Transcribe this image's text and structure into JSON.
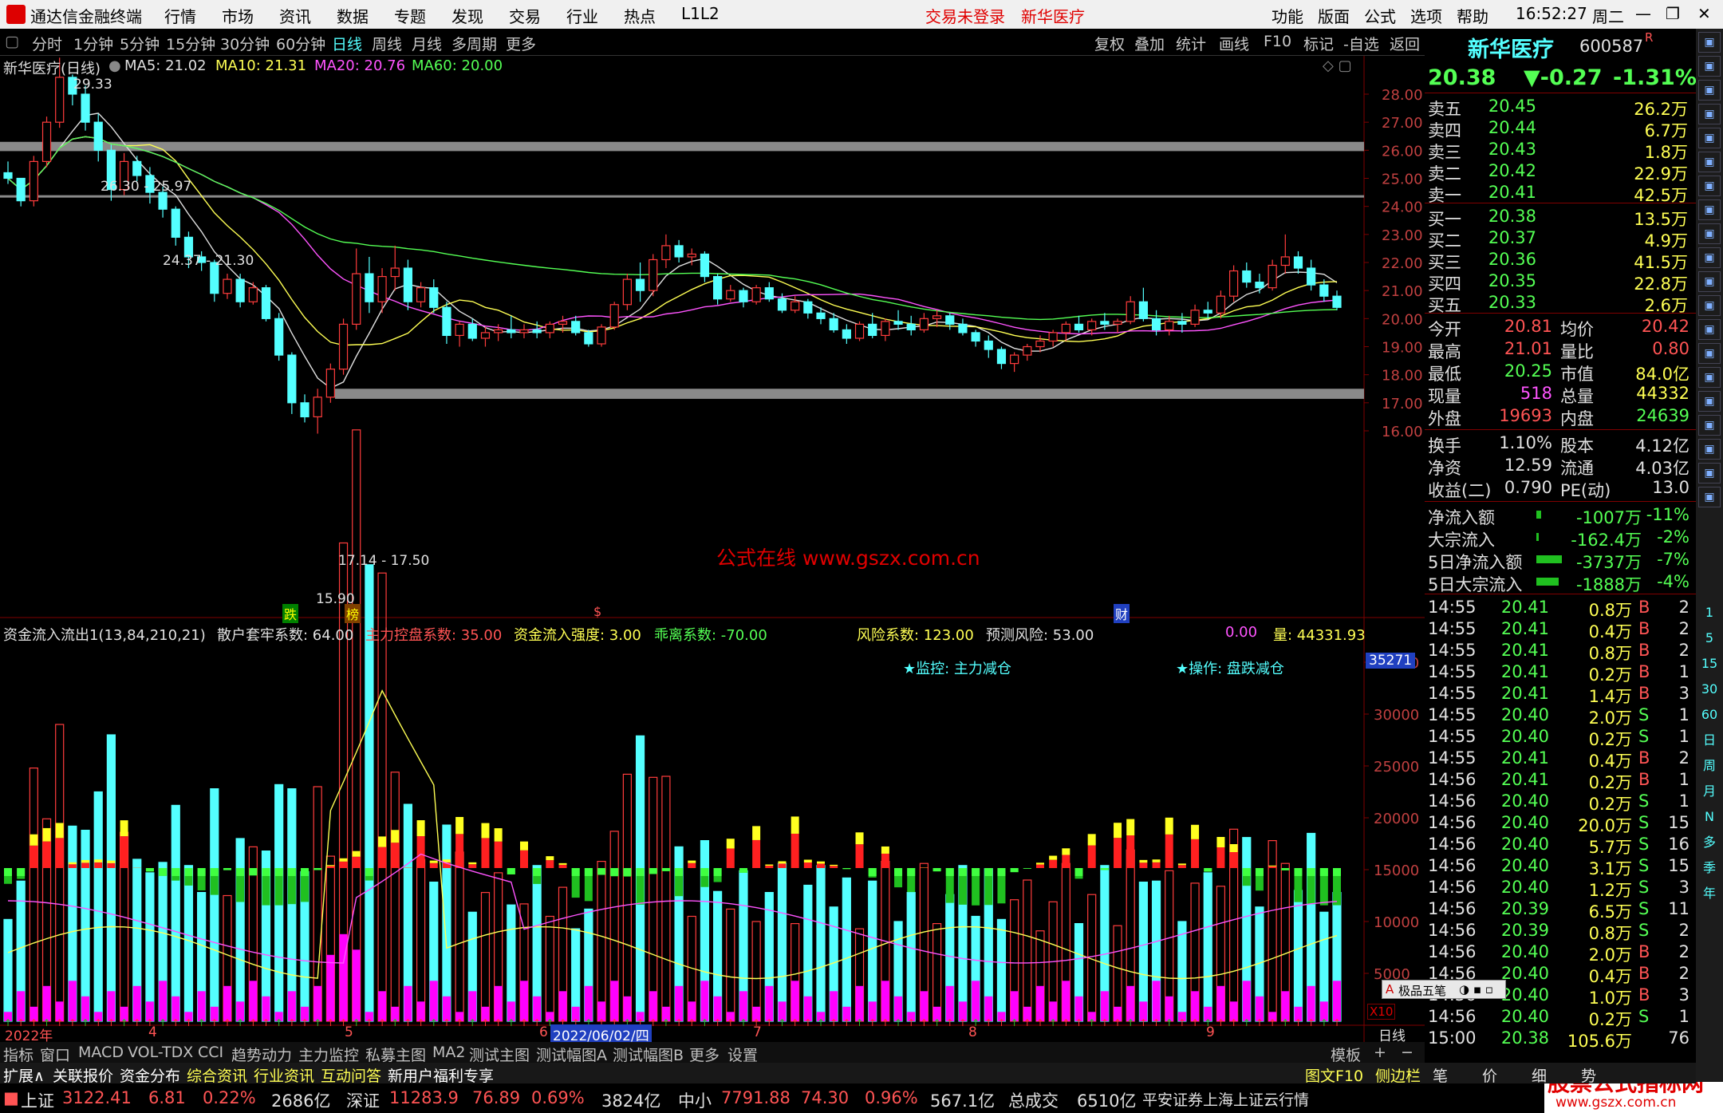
{
  "app": {
    "title": "通达信金融终端",
    "menu": [
      "行情",
      "市场",
      "资讯",
      "数据",
      "专题",
      "发现",
      "交易",
      "行业",
      "热点",
      "L1L2"
    ],
    "center_left": "交易未登录",
    "center_right": "新华医疗",
    "right_menu": [
      "功能",
      "版面",
      "公式",
      "选项",
      "帮助"
    ],
    "time": "16:52:27",
    "weekday": "周二"
  },
  "timeframes": [
    "分时",
    "1分钟",
    "5分钟",
    "15分钟",
    "30分钟",
    "60分钟",
    "日线",
    "周线",
    "月线",
    "多周期",
    "更多"
  ],
  "toolbar_right": [
    "复权",
    "叠加",
    "统计",
    "画线",
    "F10",
    "标记",
    "-自选",
    "返回"
  ],
  "chart_header": {
    "name": "新华医疗(日线)",
    "ma5": "MA5: 21.02",
    "ma10": "MA10: 21.31",
    "ma20": "MA20: 20.76",
    "ma60": "MA60: 20.00"
  },
  "price_axis": [
    "28.00",
    "27.00",
    "26.00",
    "25.00",
    "24.00",
    "23.00",
    "22.00",
    "21.00",
    "20.00",
    "19.00",
    "18.00",
    "17.00",
    "16.00"
  ],
  "annotations": {
    "high": "29.33",
    "low": "15.90",
    "z1": "26.30 - 25.97",
    "z2": "24.37 - 21.30",
    "z3": "17.14 - 17.50",
    "watermark": "公式在线  www.gszx.com.cn",
    "m1": "跌",
    "m2": "榜",
    "m3": "$",
    "m4": "财"
  },
  "indicator": {
    "name": "资金流入流出1(13,84,210,21)",
    "p1": "散户套牢系数: 64.00",
    "p2": "主力控盘系数: 35.00",
    "p3": "资金流入强度: 3.00",
    "p4": "乖离系数: -70.00",
    "p5": "风险系数: 123.00",
    "p6": "预测风险: 53.00",
    "p7": "0.00",
    "p8": "量: 44331.93",
    "monitor": "★监控: 主力减仓",
    "operation": "★操作: 盘跌减仓",
    "vol_badge": "35271",
    "x10": "X10",
    "axis": [
      "35000",
      "30000",
      "25000",
      "20000",
      "15000",
      "10000",
      "5000"
    ]
  },
  "date_axis": [
    "2022年",
    "4",
    "5",
    "6",
    "2022/06/02/四",
    "7",
    "8",
    "9",
    "日线"
  ],
  "tabs_row1": [
    "指标",
    "窗口",
    "MACD",
    "VOL-TDX",
    "CCI",
    "趋势动力",
    "主力监控",
    "私募主图",
    "MA2",
    "测试主图",
    "测试幅图A",
    "测试幅图B",
    "更多",
    "设置"
  ],
  "tabs_row2": [
    "扩展∧",
    "关联报价",
    "资金分布",
    "综合资讯",
    "行业资讯",
    "互动问答",
    "新用户福利专享"
  ],
  "template_btn": "模板",
  "status": {
    "sh": "上证",
    "sh_v": "3122.41",
    "sh_c": "6.81",
    "sh_p": "0.22%",
    "sh_a": "2686亿",
    "sz": "深证",
    "sz_v": "11283.9",
    "sz_c": "76.89",
    "sz_p": "0.69%",
    "sz_a": "3824亿",
    "zx": "中小",
    "zx_v": "7791.88",
    "zx_c": "74.30",
    "zx_p": "0.96%",
    "zx_a": "567.1亿",
    "total": "总成交",
    "total_v": "6510亿",
    "broker": "平安证券上海上证云行情",
    "logo": "股票公式指标网",
    "logo_url": "www.gszx.com.cn"
  },
  "quote": {
    "name": "新华医疗",
    "code": "600587",
    "flag": "R",
    "price": "20.38",
    "change": "▼-0.27",
    "pct": "-1.31%",
    "asks": [
      [
        "卖五",
        "20.45",
        "26.2万"
      ],
      [
        "卖四",
        "20.44",
        "6.7万"
      ],
      [
        "卖三",
        "20.43",
        "1.8万"
      ],
      [
        "卖二",
        "20.42",
        "22.9万"
      ],
      [
        "卖一",
        "20.41",
        "42.5万"
      ]
    ],
    "bids": [
      [
        "买一",
        "20.38",
        "13.5万"
      ],
      [
        "买二",
        "20.37",
        "4.9万"
      ],
      [
        "买三",
        "20.36",
        "41.5万"
      ],
      [
        "买四",
        "20.35",
        "22.8万"
      ],
      [
        "买五",
        "20.33",
        "2.6万"
      ]
    ],
    "stats": [
      [
        "今开",
        "20.81",
        "均价",
        "20.42"
      ],
      [
        "最高",
        "21.01",
        "量比",
        "0.80"
      ],
      [
        "最低",
        "20.25",
        "市值",
        "84.0亿"
      ],
      [
        "现量",
        "518",
        "总量",
        "44332"
      ],
      [
        "外盘",
        "19693",
        "内盘",
        "24639"
      ]
    ],
    "fin": [
      [
        "换手",
        "1.10%",
        "股本",
        "4.12亿"
      ],
      [
        "净资",
        "12.59",
        "流通",
        "4.03亿"
      ],
      [
        "收益(二)",
        "0.790",
        "PE(动)",
        "13.0"
      ]
    ],
    "flows": [
      [
        "净流入额",
        "-1007万",
        "-11%"
      ],
      [
        "大宗流入",
        "-162.4万",
        "-2%"
      ],
      [
        "5日净流入额",
        "-3737万",
        "-7%"
      ],
      [
        "5日大宗流入",
        "-1888万",
        "-4%"
      ]
    ],
    "ticks": [
      [
        "14:55",
        "20.41",
        "0.8万",
        "B",
        "2"
      ],
      [
        "14:55",
        "20.41",
        "0.4万",
        "B",
        "2"
      ],
      [
        "14:55",
        "20.41",
        "0.8万",
        "B",
        "2"
      ],
      [
        "14:55",
        "20.41",
        "0.2万",
        "B",
        "1"
      ],
      [
        "14:55",
        "20.41",
        "1.4万",
        "B",
        "3"
      ],
      [
        "14:55",
        "20.40",
        "2.0万",
        "S",
        "1"
      ],
      [
        "14:55",
        "20.40",
        "0.2万",
        "S",
        "1"
      ],
      [
        "14:55",
        "20.41",
        "0.4万",
        "B",
        "2"
      ],
      [
        "14:56",
        "20.41",
        "0.2万",
        "B",
        "1"
      ],
      [
        "14:56",
        "20.40",
        "0.2万",
        "S",
        "1"
      ],
      [
        "14:56",
        "20.40",
        "20.0万",
        "S",
        "15"
      ],
      [
        "14:56",
        "20.40",
        "5.7万",
        "S",
        "16"
      ],
      [
        "14:56",
        "20.40",
        "3.1万",
        "S",
        "15"
      ],
      [
        "14:56",
        "20.40",
        "1.2万",
        "S",
        "3"
      ],
      [
        "14:56",
        "20.39",
        "6.5万",
        "S",
        "11"
      ],
      [
        "14:56",
        "20.39",
        "0.8万",
        "S",
        "2"
      ],
      [
        "14:56",
        "20.40",
        "2.0万",
        "B",
        "2"
      ],
      [
        "14:56",
        "20.40",
        "0.4万",
        "B",
        "2"
      ],
      [
        "14:56",
        "20.40",
        "1.0万",
        "B",
        "3"
      ],
      [
        "14:56",
        "20.40",
        "0.2万",
        "S",
        "1"
      ],
      [
        "15:00",
        "20.38",
        "105.6万",
        "",
        "76"
      ]
    ],
    "ime": "极品五笔",
    "bottom_tabs": [
      "图文F10",
      "侧边栏",
      "笔",
      "价",
      "细",
      "势"
    ]
  },
  "side_tools": [
    "1",
    "5",
    "15",
    "30",
    "60",
    "日",
    "周",
    "月",
    "N",
    "多",
    "季",
    "年"
  ],
  "candles": [
    [
      25.2,
      25.6,
      24.8,
      25.0
    ],
    [
      25.0,
      24.9,
      24.0,
      24.2
    ],
    [
      24.2,
      25.8,
      24.0,
      25.6
    ],
    [
      25.6,
      27.2,
      25.4,
      27.0
    ],
    [
      27.0,
      29.3,
      26.8,
      28.6
    ],
    [
      28.6,
      28.7,
      27.6,
      28.0
    ],
    [
      28.0,
      28.3,
      26.7,
      27.0
    ],
    [
      27.0,
      27.3,
      25.6,
      26.0
    ],
    [
      26.0,
      26.2,
      24.2,
      24.6
    ],
    [
      24.6,
      25.9,
      24.4,
      25.6
    ],
    [
      25.6,
      25.8,
      24.9,
      25.1
    ],
    [
      25.1,
      25.4,
      24.1,
      24.5
    ],
    [
      24.5,
      24.7,
      23.6,
      23.9
    ],
    [
      23.9,
      24.0,
      22.6,
      22.9
    ],
    [
      22.9,
      23.1,
      21.8,
      22.2
    ],
    [
      22.2,
      22.4,
      21.7,
      22.0
    ],
    [
      22.0,
      22.1,
      20.6,
      20.9
    ],
    [
      20.9,
      21.6,
      20.7,
      21.4
    ],
    [
      21.4,
      21.6,
      20.4,
      20.6
    ],
    [
      20.6,
      21.3,
      20.5,
      21.1
    ],
    [
      21.1,
      21.2,
      19.9,
      20.0
    ],
    [
      20.0,
      20.2,
      18.5,
      18.7
    ],
    [
      18.7,
      18.8,
      16.6,
      17.0
    ],
    [
      17.0,
      17.3,
      16.3,
      16.5
    ],
    [
      16.5,
      17.5,
      15.9,
      17.2
    ],
    [
      17.2,
      18.4,
      17.0,
      18.2
    ],
    [
      18.2,
      20.0,
      18.0,
      19.8
    ],
    [
      19.8,
      22.5,
      19.6,
      21.6
    ],
    [
      21.6,
      22.2,
      20.2,
      20.6
    ],
    [
      20.6,
      21.8,
      20.2,
      21.5
    ],
    [
      21.5,
      22.6,
      21.0,
      21.8
    ],
    [
      21.8,
      22.1,
      20.3,
      20.6
    ],
    [
      20.6,
      21.3,
      20.4,
      21.1
    ],
    [
      21.1,
      21.4,
      20.2,
      20.4
    ],
    [
      20.4,
      20.6,
      19.1,
      19.4
    ],
    [
      19.4,
      19.9,
      19.0,
      19.8
    ],
    [
      19.8,
      20.0,
      19.2,
      19.3
    ],
    [
      19.3,
      19.7,
      19.0,
      19.5
    ],
    [
      19.5,
      19.8,
      19.2,
      19.6
    ],
    [
      19.6,
      20.1,
      19.3,
      19.5
    ],
    [
      19.5,
      19.8,
      19.3,
      19.6
    ],
    [
      19.6,
      19.9,
      19.3,
      19.5
    ],
    [
      19.5,
      19.9,
      19.3,
      19.8
    ],
    [
      19.8,
      20.1,
      19.5,
      19.9
    ],
    [
      19.9,
      20.1,
      19.4,
      19.5
    ],
    [
      19.5,
      19.6,
      19.0,
      19.1
    ],
    [
      19.1,
      19.8,
      19.0,
      19.7
    ],
    [
      19.7,
      20.6,
      19.6,
      20.5
    ],
    [
      20.5,
      21.6,
      20.3,
      21.4
    ],
    [
      21.4,
      22.0,
      20.6,
      21.0
    ],
    [
      21.0,
      22.3,
      20.8,
      22.1
    ],
    [
      22.1,
      23.0,
      21.8,
      22.6
    ],
    [
      22.6,
      22.8,
      22.0,
      22.2
    ],
    [
      22.2,
      22.5,
      21.9,
      22.3
    ],
    [
      22.3,
      22.4,
      21.3,
      21.5
    ],
    [
      21.5,
      21.6,
      20.5,
      20.7
    ],
    [
      20.7,
      21.2,
      20.6,
      21.0
    ],
    [
      21.0,
      21.1,
      20.4,
      20.6
    ],
    [
      20.6,
      21.2,
      20.5,
      21.1
    ],
    [
      21.1,
      21.3,
      20.6,
      20.7
    ],
    [
      20.7,
      20.9,
      20.2,
      20.3
    ],
    [
      20.3,
      20.8,
      20.2,
      20.6
    ],
    [
      20.6,
      20.7,
      20.0,
      20.2
    ],
    [
      20.2,
      20.4,
      19.8,
      20.0
    ],
    [
      20.0,
      20.2,
      19.5,
      19.6
    ],
    [
      19.6,
      19.8,
      19.1,
      19.3
    ],
    [
      19.3,
      19.9,
      19.2,
      19.8
    ],
    [
      19.8,
      20.2,
      19.3,
      19.4
    ],
    [
      19.4,
      20.0,
      19.2,
      19.9
    ],
    [
      19.9,
      20.3,
      19.6,
      19.8
    ],
    [
      19.8,
      20.1,
      19.4,
      19.6
    ],
    [
      19.6,
      20.2,
      19.5,
      20.0
    ],
    [
      20.0,
      20.3,
      19.7,
      20.1
    ],
    [
      20.1,
      20.2,
      19.6,
      19.8
    ],
    [
      19.8,
      20.0,
      19.4,
      19.5
    ],
    [
      19.5,
      19.6,
      19.0,
      19.2
    ],
    [
      19.2,
      19.4,
      18.6,
      18.9
    ],
    [
      18.9,
      19.0,
      18.2,
      18.4
    ],
    [
      18.4,
      18.8,
      18.1,
      18.7
    ],
    [
      18.7,
      19.1,
      18.5,
      19.0
    ],
    [
      19.0,
      19.4,
      18.8,
      19.2
    ],
    [
      19.2,
      19.6,
      19.0,
      19.5
    ],
    [
      19.5,
      19.9,
      19.2,
      19.8
    ],
    [
      19.8,
      20.1,
      19.5,
      19.6
    ],
    [
      19.6,
      20.0,
      19.4,
      19.9
    ],
    [
      19.9,
      20.2,
      19.6,
      19.8
    ],
    [
      19.8,
      20.0,
      19.5,
      19.9
    ],
    [
      19.9,
      20.8,
      19.8,
      20.6
    ],
    [
      20.6,
      21.1,
      19.9,
      20.0
    ],
    [
      20.0,
      20.3,
      19.4,
      19.6
    ],
    [
      19.6,
      20.1,
      19.4,
      19.9
    ],
    [
      19.9,
      20.2,
      19.5,
      19.8
    ],
    [
      19.8,
      20.5,
      19.7,
      20.3
    ],
    [
      20.3,
      20.6,
      20.0,
      20.2
    ],
    [
      20.2,
      21.0,
      20.0,
      20.8
    ],
    [
      20.8,
      21.9,
      20.6,
      21.7
    ],
    [
      21.7,
      22.0,
      21.1,
      21.3
    ],
    [
      21.3,
      21.6,
      20.9,
      21.1
    ],
    [
      21.1,
      22.1,
      21.0,
      21.9
    ],
    [
      21.9,
      23.0,
      21.6,
      22.2
    ],
    [
      22.2,
      22.4,
      21.6,
      21.8
    ],
    [
      21.8,
      22.1,
      21.0,
      21.2
    ],
    [
      21.2,
      21.4,
      20.6,
      20.8
    ],
    [
      20.8,
      21.0,
      20.3,
      20.4
    ]
  ],
  "chart_data": {
    "type": "candlestick",
    "title": "新华医疗(日线)",
    "ylim": [
      15.5,
      29.8
    ],
    "ma": [
      {
        "name": "MA5",
        "value": 21.02
      },
      {
        "name": "MA10",
        "value": 21.31
      },
      {
        "name": "MA20",
        "value": 20.76
      },
      {
        "name": "MA60",
        "value": 20.0
      }
    ],
    "zones": [
      [
        26.3,
        25.97
      ],
      [
        24.37,
        24.37
      ],
      [
        17.5,
        17.14
      ]
    ]
  }
}
